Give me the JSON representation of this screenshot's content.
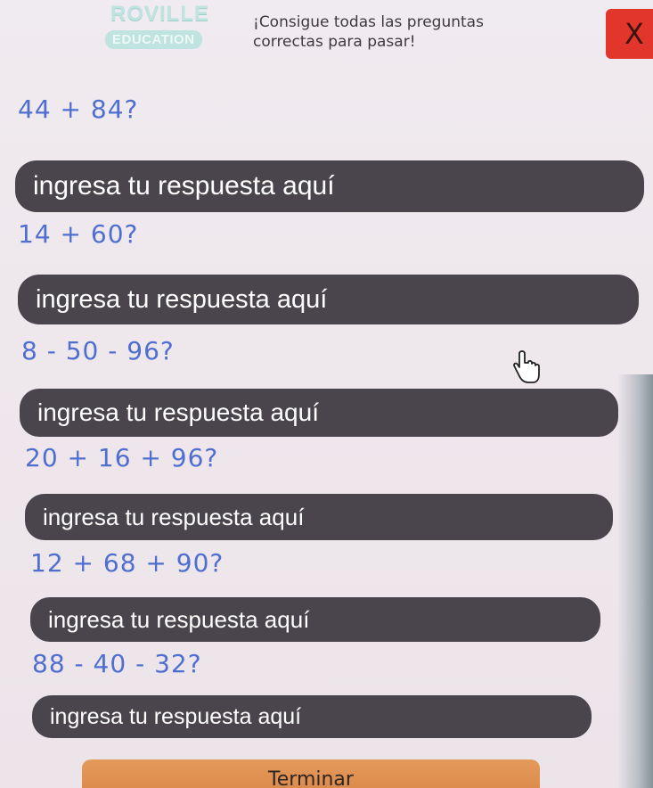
{
  "header": {
    "logo_top": "ROVILLE",
    "logo_bottom": "EDUCATION",
    "instructions_line1": "¡Consigue todas las preguntas",
    "instructions_line2": "correctas para pasar!",
    "close_label": "X"
  },
  "colors": {
    "question_text": "#4f6fd0",
    "answer_field_bg": "#4a454c",
    "close_button": "#e2352c",
    "finish_button": "#d98445"
  },
  "questions": [
    {
      "text": "44 + 84?",
      "placeholder": "ingresa tu respuesta aquí"
    },
    {
      "text": "14 + 60?",
      "placeholder": "ingresa tu respuesta aquí"
    },
    {
      "text": "8 - 50 - 96?",
      "placeholder": "ingresa tu respuesta aquí"
    },
    {
      "text": "20 + 16 + 96?",
      "placeholder": "ingresa tu respuesta aquí"
    },
    {
      "text": "12 + 68 + 90?",
      "placeholder": "ingresa tu respuesta aquí"
    },
    {
      "text": "88 - 40 - 32?",
      "placeholder": "ingresa tu respuesta aquí"
    }
  ],
  "cursor": {
    "icon": "hand-pointer-icon"
  },
  "footer": {
    "finish_label": "Terminar"
  }
}
